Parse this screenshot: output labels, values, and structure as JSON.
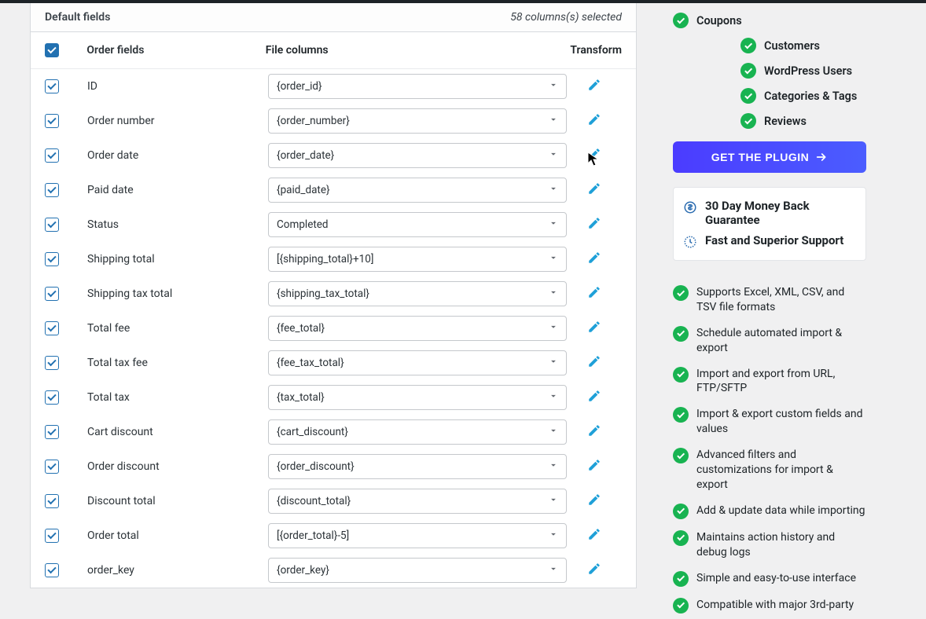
{
  "panel": {
    "title": "Default fields",
    "columns_selected_text": "58 columns(s) selected"
  },
  "headers": {
    "order_fields": "Order fields",
    "file_columns": "File columns",
    "transform": "Transform"
  },
  "rows": [
    {
      "name": "ID",
      "column": "{order_id}"
    },
    {
      "name": "Order number",
      "column": "{order_number}"
    },
    {
      "name": "Order date",
      "column": "{order_date}"
    },
    {
      "name": "Paid date",
      "column": "{paid_date}"
    },
    {
      "name": "Status",
      "column": "Completed"
    },
    {
      "name": "Shipping total",
      "column": "[{shipping_total}+10]"
    },
    {
      "name": "Shipping tax total",
      "column": "{shipping_tax_total}"
    },
    {
      "name": "Total fee",
      "column": "{fee_total}"
    },
    {
      "name": "Total tax fee",
      "column": "{fee_tax_total}"
    },
    {
      "name": "Total tax",
      "column": "{tax_total}"
    },
    {
      "name": "Cart discount",
      "column": "{cart_discount}"
    },
    {
      "name": "Order discount",
      "column": "{order_discount}"
    },
    {
      "name": "Discount total",
      "column": "{discount_total}"
    },
    {
      "name": "Order total",
      "column": "[{order_total}-5]"
    },
    {
      "name": "order_key",
      "column": "{order_key}"
    }
  ],
  "sidebar": {
    "top_items": [
      {
        "label": "Coupons",
        "indent": false
      },
      {
        "label": "Customers",
        "indent": true
      },
      {
        "label": "WordPress Users",
        "indent": true
      },
      {
        "label": "Categories & Tags",
        "indent": true
      },
      {
        "label": "Reviews",
        "indent": true
      }
    ],
    "cta": "GET THE PLUGIN",
    "guarantee": "30 Day Money Back Guarantee",
    "support": "Fast and Superior Support",
    "features": [
      "Supports Excel, XML, CSV, and TSV file formats",
      "Schedule automated import & export",
      "Import and export from URL, FTP/SFTP",
      "Import & export custom fields and values",
      "Advanced filters and customizations for import & export",
      "Add & update data while importing",
      "Maintains action history and debug logs",
      "Simple and easy-to-use interface",
      "Compatible with major 3rd-party"
    ]
  }
}
